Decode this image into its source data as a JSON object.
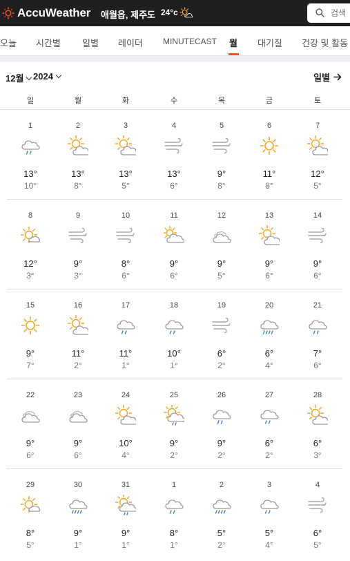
{
  "header": {
    "brand": "AccuWeather",
    "location": "애월읍, 제주도",
    "temp": "24°c",
    "search_placeholder": "검색"
  },
  "nav": {
    "tabs": [
      {
        "label": "오늘",
        "active": false
      },
      {
        "label": "시간별",
        "active": false
      },
      {
        "label": "일별",
        "active": false
      },
      {
        "label": "레이더",
        "active": false
      },
      {
        "label": "MINUTECAST",
        "active": false
      },
      {
        "label": "월",
        "active": true
      },
      {
        "label": "대기질",
        "active": false
      },
      {
        "label": "건강 및 활동",
        "active": false
      }
    ]
  },
  "calendar": {
    "month": "12월",
    "year": "2024",
    "daily_link": "일별",
    "weekdays": [
      "일",
      "월",
      "화",
      "수",
      "목",
      "금",
      "토"
    ],
    "weeks": [
      [
        {
          "date": "1",
          "icon": "cloud-rain",
          "hi": "13°",
          "lo": "10°"
        },
        {
          "date": "2",
          "icon": "sun-cloud",
          "hi": "13°",
          "lo": "8°"
        },
        {
          "date": "3",
          "icon": "sun-cloud",
          "hi": "13°",
          "lo": "5°"
        },
        {
          "date": "4",
          "icon": "wind",
          "hi": "13°",
          "lo": "6°"
        },
        {
          "date": "5",
          "icon": "wind",
          "hi": "9°",
          "lo": "8°"
        },
        {
          "date": "6",
          "icon": "sun",
          "hi": "11°",
          "lo": "8°"
        },
        {
          "date": "7",
          "icon": "sun-cloud",
          "hi": "12°",
          "lo": "5°"
        }
      ],
      [
        {
          "date": "8",
          "icon": "sun-small-cloud",
          "hi": "12°",
          "lo": "3°"
        },
        {
          "date": "9",
          "icon": "wind",
          "hi": "9°",
          "lo": "3°"
        },
        {
          "date": "10",
          "icon": "wind",
          "hi": "8°",
          "lo": "6°"
        },
        {
          "date": "11",
          "icon": "sun-behind-cloud",
          "hi": "9°",
          "lo": "6°"
        },
        {
          "date": "12",
          "icon": "cloudy",
          "hi": "9°",
          "lo": "5°"
        },
        {
          "date": "13",
          "icon": "sun-cloud",
          "hi": "9°",
          "lo": "6°"
        },
        {
          "date": "14",
          "icon": "wind",
          "hi": "9°",
          "lo": "6°"
        }
      ],
      [
        {
          "date": "15",
          "icon": "sun",
          "hi": "9°",
          "lo": "7°"
        },
        {
          "date": "16",
          "icon": "sun-cloud",
          "hi": "11°",
          "lo": "2°"
        },
        {
          "date": "17",
          "icon": "cloud-rain",
          "hi": "11°",
          "lo": "1°"
        },
        {
          "date": "18",
          "icon": "cloud-rain",
          "hi": "10°",
          "lo": "1°"
        },
        {
          "date": "19",
          "icon": "wind",
          "hi": "6°",
          "lo": "2°"
        },
        {
          "date": "20",
          "icon": "cloud-heavy-rain",
          "hi": "6°",
          "lo": "4°"
        },
        {
          "date": "21",
          "icon": "cloud-rain",
          "hi": "7°",
          "lo": "6°"
        }
      ],
      [
        {
          "date": "22",
          "icon": "cloudy",
          "hi": "9°",
          "lo": "6°"
        },
        {
          "date": "23",
          "icon": "cloudy",
          "hi": "9°",
          "lo": "6°"
        },
        {
          "date": "24",
          "icon": "sun-cloud",
          "hi": "10°",
          "lo": "4°"
        },
        {
          "date": "25",
          "icon": "sun-cloud-rain",
          "hi": "9°",
          "lo": "2°"
        },
        {
          "date": "26",
          "icon": "cloud-rain",
          "hi": "9°",
          "lo": "2°"
        },
        {
          "date": "27",
          "icon": "cloud-rain",
          "hi": "6°",
          "lo": "2°"
        },
        {
          "date": "28",
          "icon": "sun-cloud",
          "hi": "6°",
          "lo": "3°"
        }
      ],
      [
        {
          "date": "29",
          "icon": "sun-small-cloud",
          "hi": "8°",
          "lo": "5°"
        },
        {
          "date": "30",
          "icon": "cloud-heavy-rain",
          "hi": "9°",
          "lo": "1°"
        },
        {
          "date": "31",
          "icon": "sun-cloud-rain",
          "hi": "9°",
          "lo": "1°"
        },
        {
          "date": "1",
          "icon": "cloud-rain",
          "hi": "8°",
          "lo": "1°"
        },
        {
          "date": "2",
          "icon": "cloud-heavy-rain",
          "hi": "5°",
          "lo": "2°"
        },
        {
          "date": "3",
          "icon": "cloud-rain",
          "hi": "5°",
          "lo": "4°"
        },
        {
          "date": "4",
          "icon": "wind",
          "hi": "6°",
          "lo": "5°"
        }
      ]
    ]
  },
  "colors": {
    "accent": "#f05514",
    "sun": "#f5a623",
    "cloud": "#9a9a9a",
    "rain": "#4a7fc1"
  }
}
